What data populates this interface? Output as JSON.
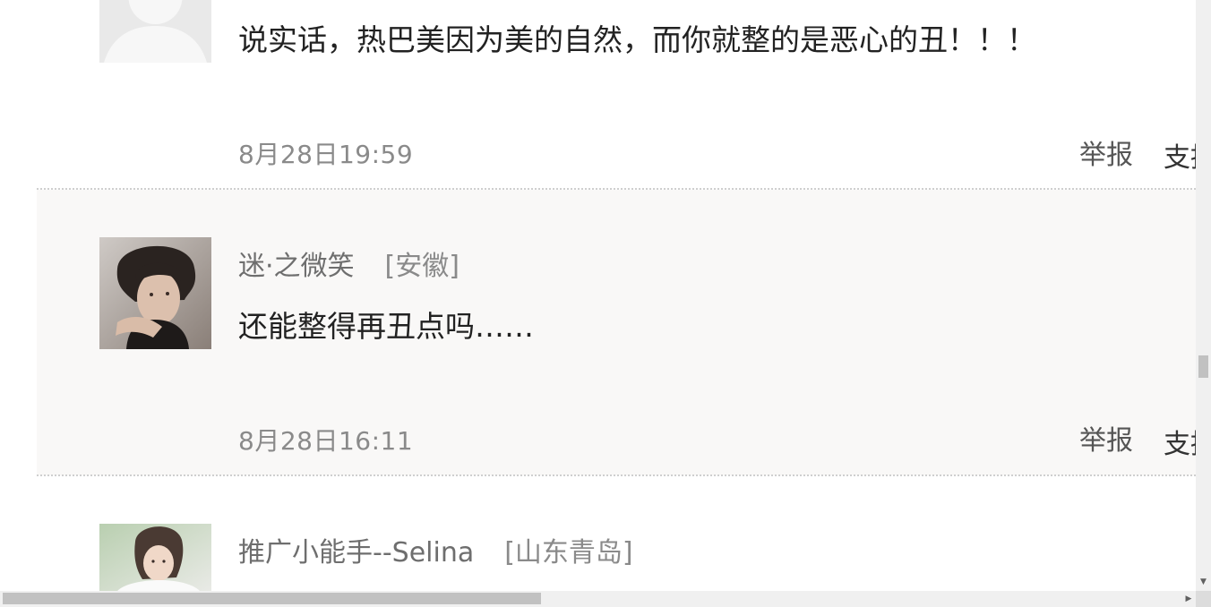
{
  "comments": [
    {
      "content": "说实话，热巴美因为美的自然，而你就整的是恶心的丑！！！",
      "time": "8月28日19:59",
      "report_label": "举报",
      "support_label": "支持"
    },
    {
      "username": "迷·之微笑",
      "location": "[安徽]",
      "content": "还能整得再丑点吗……",
      "time": "8月28日16:11",
      "report_label": "举报",
      "support_label": "支持"
    },
    {
      "username": "推广小能手--Selina",
      "location": "[山东青岛]"
    }
  ],
  "colors": {
    "alt_row_bg": "#f9f8f7",
    "divider": "#cfcfcf",
    "text_main": "#222222",
    "text_meta": "#8a8a8a"
  },
  "icons": {
    "scroll_down": "triangle-down",
    "scroll_right": "triangle-right"
  }
}
